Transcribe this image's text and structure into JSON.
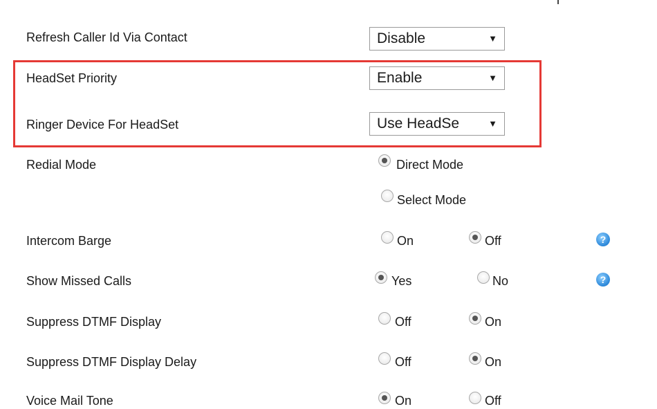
{
  "settings": {
    "refresh_caller_id": {
      "label": "Refresh Caller Id Via Contact",
      "value": "Disable"
    },
    "headset_priority": {
      "label": "HeadSet Priority",
      "value": "Enable"
    },
    "ringer_device": {
      "label": "Ringer Device For HeadSet",
      "value": "Use HeadSe"
    },
    "redial_mode": {
      "label": "Redial Mode",
      "options": [
        "Direct Mode",
        "Select Mode"
      ],
      "selected": "Direct Mode"
    },
    "intercom_barge": {
      "label": "Intercom Barge",
      "options": [
        "On",
        "Off"
      ],
      "selected": "Off"
    },
    "show_missed_calls": {
      "label": "Show Missed Calls",
      "options": [
        "Yes",
        "No"
      ],
      "selected": "Yes"
    },
    "suppress_dtmf": {
      "label": "Suppress DTMF Display",
      "options": [
        "Off",
        "On"
      ],
      "selected": "On"
    },
    "suppress_dtmf_delay": {
      "label": "Suppress DTMF Display Delay",
      "options": [
        "Off",
        "On"
      ],
      "selected": "On"
    },
    "voice_mail_tone": {
      "label": "Voice Mail Tone",
      "options": [
        "On",
        "Off"
      ],
      "selected": "On"
    }
  },
  "icons": {
    "dropdown_arrow": "▼",
    "help": "?"
  },
  "colors": {
    "highlight_border": "#e53935",
    "help_icon": "#2b87d9"
  }
}
